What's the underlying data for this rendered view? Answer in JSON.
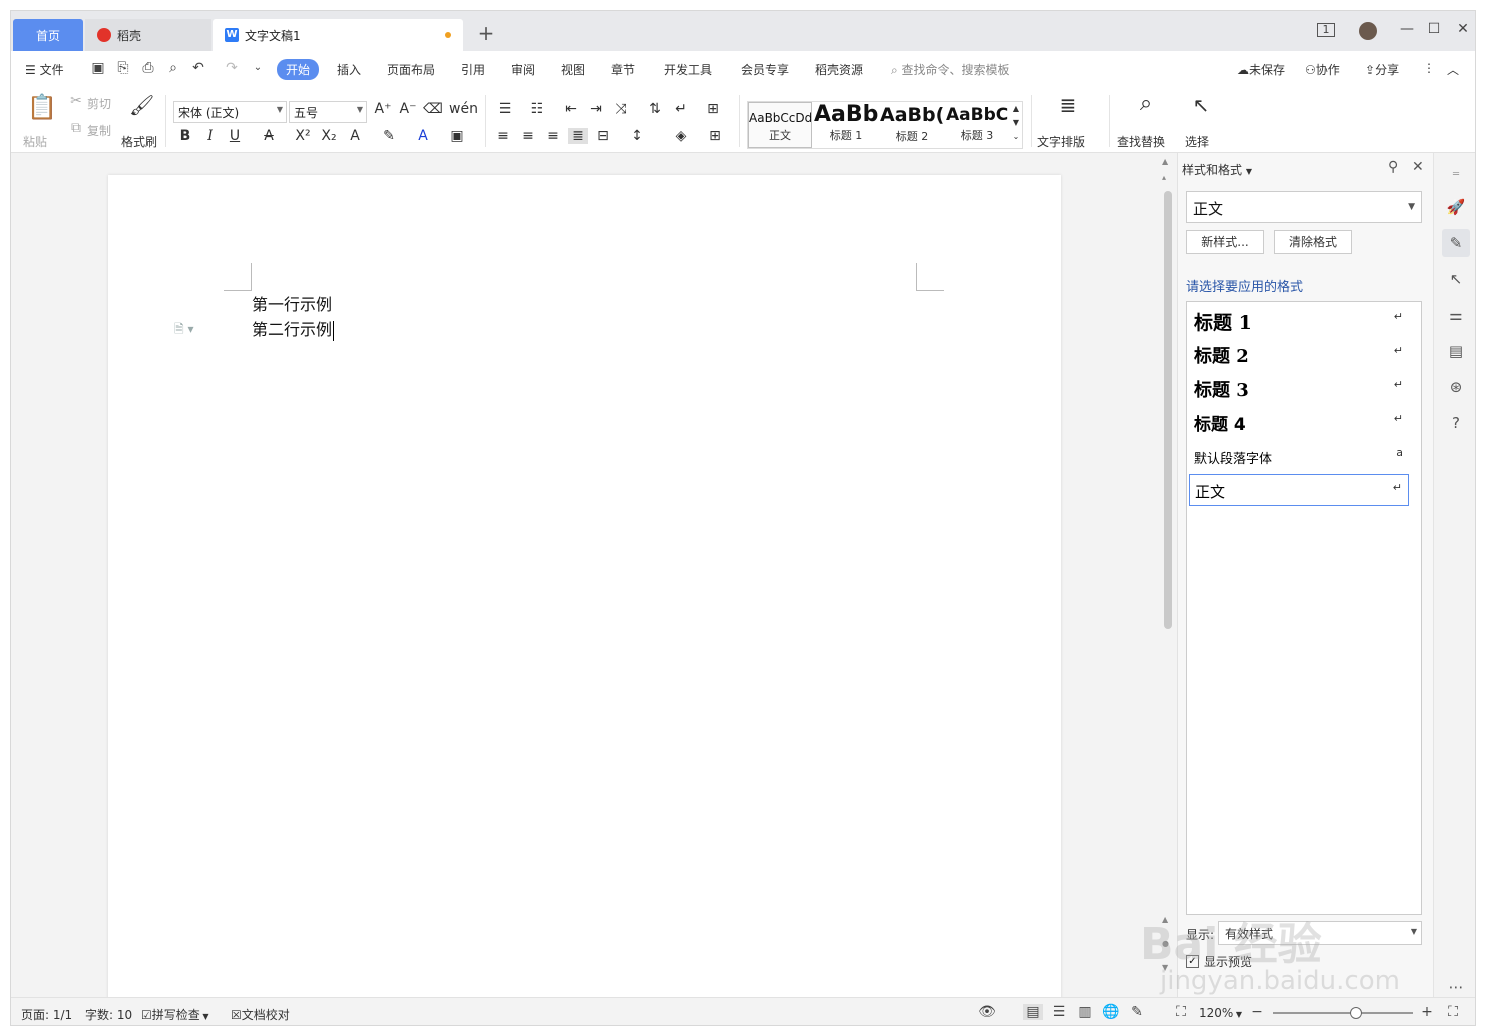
{
  "titlebar": {
    "tabs": [
      {
        "label": "首页"
      },
      {
        "label": "稻壳"
      },
      {
        "label": "文字文稿1"
      }
    ],
    "new_tab": "+",
    "layout_badge": "1"
  },
  "menubar": {
    "file": "文件",
    "items": [
      "开始",
      "插入",
      "页面布局",
      "引用",
      "审阅",
      "视图",
      "章节",
      "开发工具",
      "会员专享",
      "稻壳资源"
    ],
    "search_placeholder": "查找命令、搜索模板",
    "unsaved": "未保存",
    "collab": "协作",
    "share": "分享"
  },
  "ribbon": {
    "paste": "粘贴",
    "cut": "剪切",
    "copy": "复制",
    "format_painter": "格式刷",
    "font_name": "宋体 (正文)",
    "font_size": "五号",
    "styles": [
      {
        "preview": "AaBbCcDd",
        "label": "正文"
      },
      {
        "preview": "AaBb",
        "label": "标题 1"
      },
      {
        "preview": "AaBb(",
        "label": "标题 2"
      },
      {
        "preview": "AaBbC(",
        "label": "标题 3"
      }
    ],
    "text_layout": "文字排版",
    "find_replace": "查找替换",
    "select": "选择"
  },
  "document": {
    "lines": [
      "第一行示例",
      "第二行示例"
    ]
  },
  "panel": {
    "title": "样式和格式",
    "current_style": "正文",
    "new_style_btn": "新样式...",
    "clear_format_btn": "清除格式",
    "subtitle": "请选择要应用的格式",
    "styles": [
      {
        "name": "标题  1",
        "mark": "↵"
      },
      {
        "name": "标题  2",
        "mark": "↵"
      },
      {
        "name": "标题  3",
        "mark": "↵"
      },
      {
        "name": "标题  4",
        "mark": "↵"
      },
      {
        "name": "默认段落字体",
        "mark": "a"
      },
      {
        "name": "正文",
        "mark": "↵"
      }
    ],
    "show_label": "显示:",
    "show_value": "有效样式",
    "preview_label": "显示预览"
  },
  "statusbar": {
    "page": "页面: 1/1",
    "words": "字数: 10",
    "spell": "拼写检查",
    "proof": "文档校对",
    "zoom": "120%",
    "zoom_level": 0.59
  },
  "watermark": {
    "text": "Bai 经验",
    "url": "jingyan.baidu.com"
  },
  "colors": {
    "accent": "#5b8def",
    "panel_subtitle": "#2a56a8",
    "unsaved_dot": "#f0a020"
  }
}
